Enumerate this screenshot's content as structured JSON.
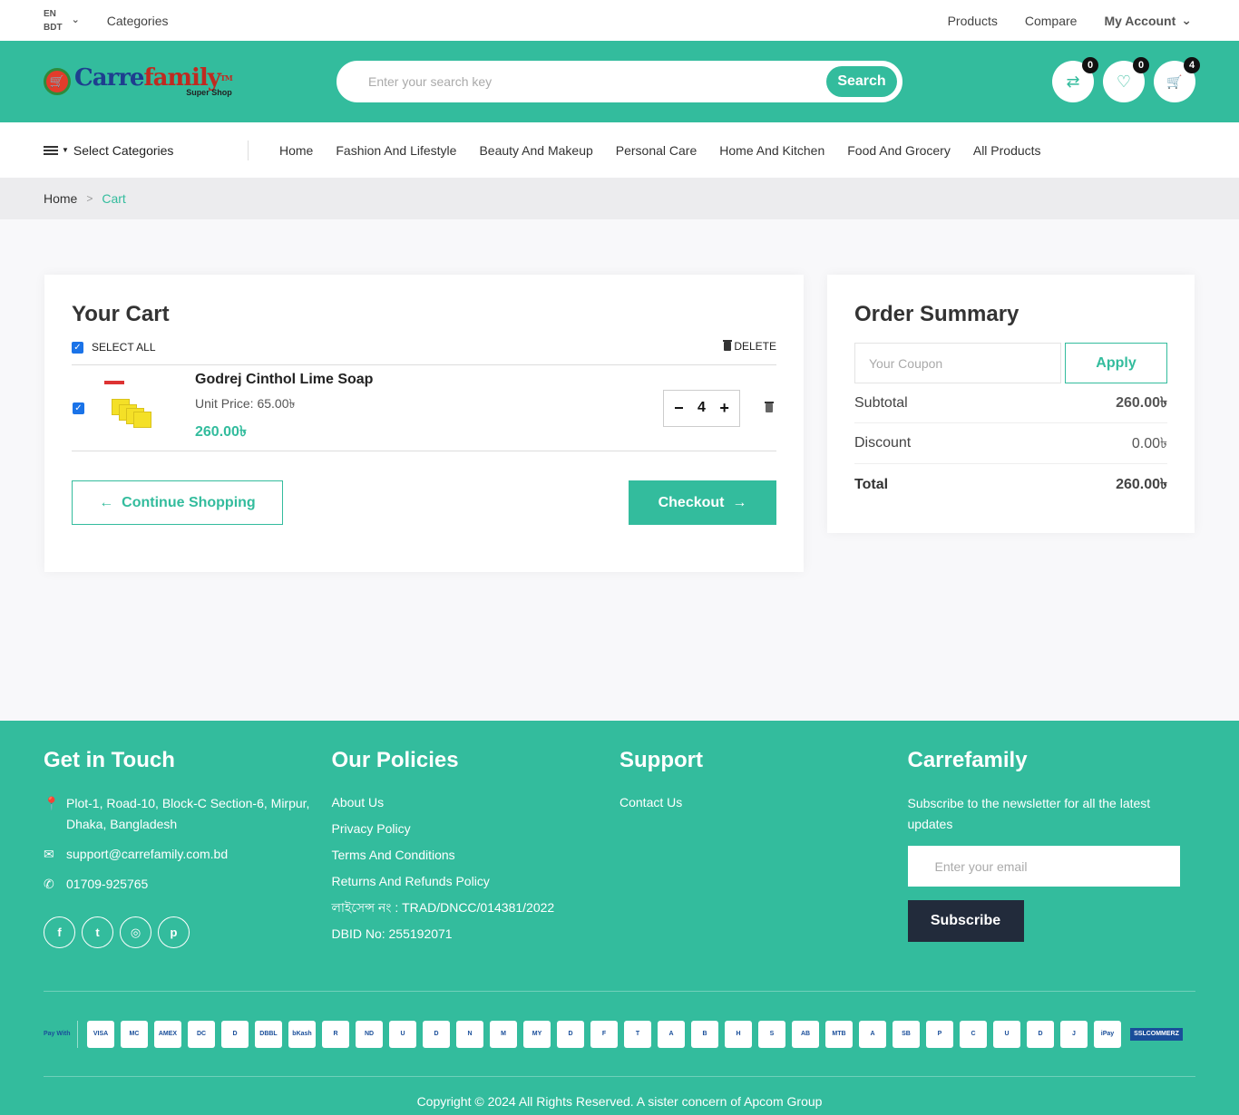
{
  "topbar": {
    "lang": "EN",
    "currency": "BDT",
    "categories": "Categories",
    "links": [
      "Products",
      "Compare"
    ],
    "account": "My Account"
  },
  "header": {
    "logo_name_part1": "Carre",
    "logo_name_part2": "family",
    "logo_tm": "TM",
    "logo_sub": "Super Shop",
    "search_placeholder": "Enter your search key",
    "search_button": "Search",
    "compare_count": "0",
    "wishlist_count": "0",
    "cart_count": "4"
  },
  "nav": {
    "select_categories": "Select Categories",
    "links": [
      "Home",
      "Fashion And Lifestyle",
      "Beauty And Makeup",
      "Personal Care",
      "Home And Kitchen",
      "Food And Grocery",
      "All Products"
    ]
  },
  "breadcrumb": {
    "home": "Home",
    "sep": ">",
    "current": "Cart"
  },
  "cart": {
    "title": "Your Cart",
    "select_all": "SELECT ALL",
    "delete": "DELETE",
    "item": {
      "name": "Godrej Cinthol Lime Soap",
      "unit_price": "Unit Price: 65.00৳",
      "line_price": "260.00৳",
      "qty": "4"
    },
    "continue": "Continue Shopping",
    "checkout": "Checkout"
  },
  "summary": {
    "title": "Order Summary",
    "coupon_placeholder": "Your Coupon",
    "apply": "Apply",
    "subtotal_label": "Subtotal",
    "subtotal": "260.00৳",
    "discount_label": "Discount",
    "discount": "0.00৳",
    "total_label": "Total",
    "total": "260.00৳"
  },
  "footer": {
    "contact_title": "Get in Touch",
    "address": "Plot-1, Road-10, Block-C Section-6, Mirpur, Dhaka, Bangladesh",
    "email": "support@carrefamily.com.bd",
    "phone": "01709-925765",
    "policies_title": "Our Policies",
    "policies": [
      "About Us",
      "Privacy Policy",
      "Terms And Conditions",
      "Returns And Refunds Policy",
      "লাইসেন্স নং : TRAD/DNCC/014381/2022",
      "DBID No: 255192071"
    ],
    "support_title": "Support",
    "support_links": [
      "Contact Us"
    ],
    "brand_title": "Carrefamily",
    "newsletter_text": "Subscribe to the newsletter for all the latest updates",
    "email_placeholder": "Enter your email",
    "subscribe": "Subscribe",
    "pay_with": "Pay With",
    "payment_logos": [
      "VISA",
      "MC",
      "AMEX",
      "DC",
      "D",
      "DBBL",
      "bKash",
      "R",
      "ND",
      "U",
      "D",
      "N",
      "M",
      "MY",
      "D",
      "F",
      "T",
      "A",
      "B",
      "H",
      "S",
      "AB",
      "MTB",
      "A",
      "SB",
      "P",
      "C",
      "U",
      "D",
      "J",
      "iPay"
    ],
    "ssl": "SSLCOMMERZ",
    "copyright": "Copyright © 2024 All Rights Reserved. A sister concern of Apcom Group"
  },
  "colors": {
    "brand": "#33bc9d",
    "dark": "#222b3b"
  }
}
